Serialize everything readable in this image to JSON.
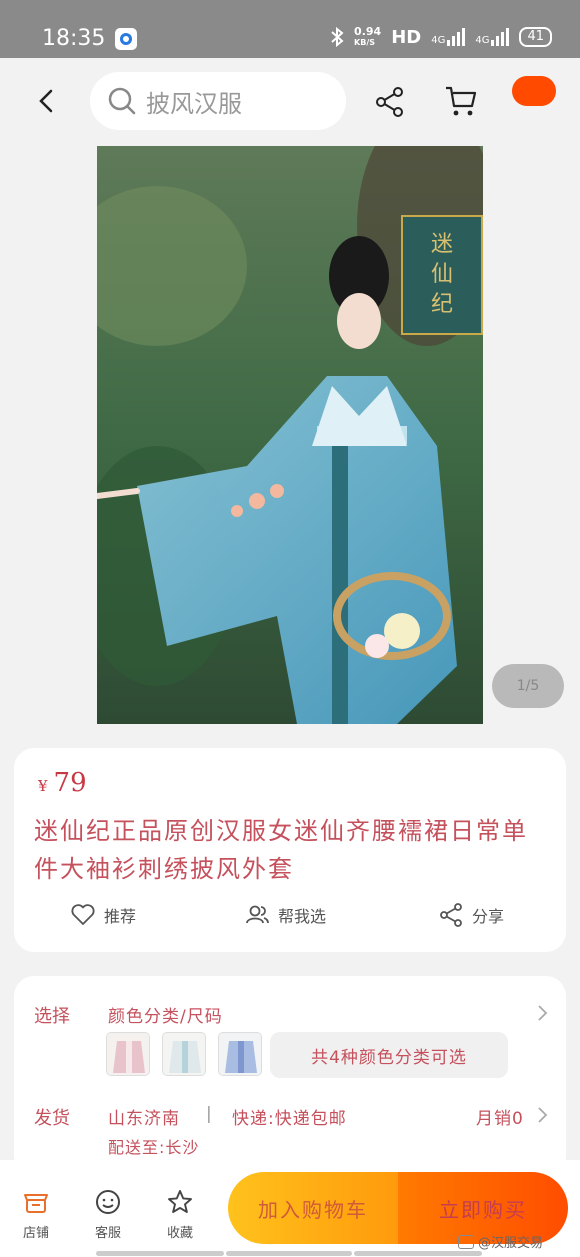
{
  "status": {
    "time": "18:35",
    "net_speed": "0.94",
    "net_unit": "KB/S",
    "hd": "HD",
    "net_type_1": "4G",
    "net_type_2": "4G",
    "battery": "41"
  },
  "nav": {
    "search_placeholder": "披风汉服"
  },
  "gallery": {
    "pager": "1/5"
  },
  "product": {
    "currency": "¥",
    "price": "79",
    "title": "迷仙纪正品原创汉服女迷仙齐腰襦裙日常单件大袖衫刺绣披风外套"
  },
  "actions": {
    "recommend": "推荐",
    "help_choose": "帮我选",
    "share": "分享"
  },
  "selection": {
    "select_label": "选择",
    "select_value": "颜色分类/尺码",
    "color_count": "共4种颜色分类可选",
    "ship_label": "发货",
    "ship_from": "山东济南",
    "separator": "|",
    "express": "快递:快递包邮",
    "monthly_sales": "月销0",
    "deliver_to": "配送至:长沙"
  },
  "bottom_bar": {
    "store": "店铺",
    "service": "客服",
    "favorite": "收藏",
    "add_to_cart": "加入购物车",
    "buy_now": "立即购买"
  },
  "watermark": "@汉服交易",
  "colors": {
    "accent": "#ff4d00",
    "cart_button": "#ffb81a",
    "price_text": "#c73a45"
  }
}
